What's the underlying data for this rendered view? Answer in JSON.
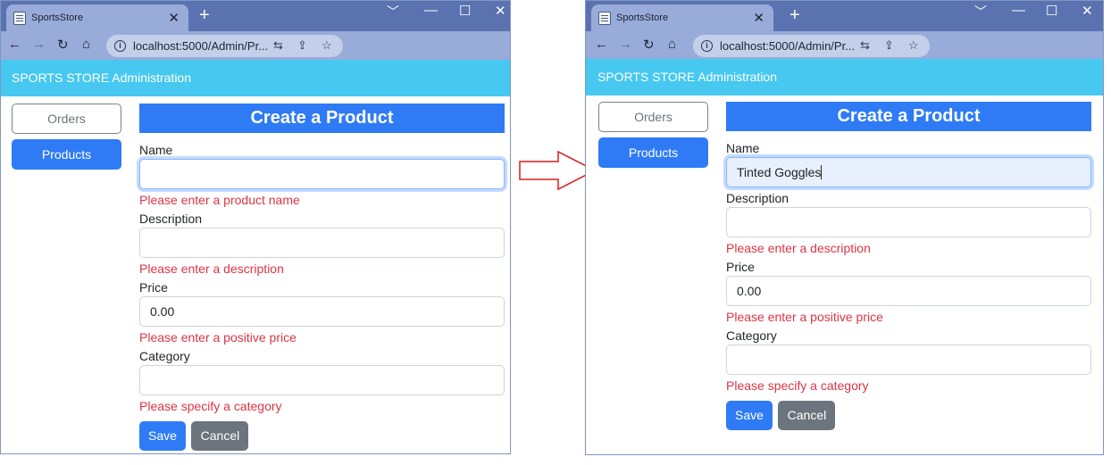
{
  "browser": {
    "tab_title": "SportsStore",
    "url": "localhost:5000/Admin/Pr...",
    "new_tab": "+",
    "close_tab": "✕",
    "window_controls": {
      "minimize": "﹀",
      "restore": "—",
      "maximize": "☐",
      "close": "✕"
    },
    "nav": {
      "back": "←",
      "forward": "→",
      "reload": "↻",
      "home": "⌂"
    },
    "address_icons": {
      "info": "i",
      "translate": "⇆",
      "share": "⇪",
      "star": "☆"
    }
  },
  "app": {
    "brand": "SPORTS STORE Administration",
    "nav": {
      "orders": "Orders",
      "products": "Products"
    }
  },
  "form": {
    "title": "Create a Product",
    "labels": {
      "name": "Name",
      "description": "Description",
      "price": "Price",
      "category": "Category"
    },
    "buttons": {
      "save": "Save",
      "cancel": "Cancel"
    }
  },
  "before": {
    "name_value": "",
    "description_value": "",
    "price_value": "0.00",
    "category_value": "",
    "errors": {
      "name": "Please enter a product name",
      "description": "Please enter a description",
      "price": "Please enter a positive price",
      "category": "Please specify a category"
    }
  },
  "after": {
    "name_value": "Tinted Goggles",
    "description_value": "",
    "price_value": "0.00",
    "category_value": "",
    "errors": {
      "description": "Please enter a description",
      "price": "Please enter a positive price",
      "category": "Please specify a category"
    }
  },
  "colors": {
    "brand_bar": "#46c8f0",
    "primary": "#2f7bf5",
    "secondary": "#6c757d",
    "error": "#dc3545",
    "arrow_stroke": "#dd1a1a"
  }
}
